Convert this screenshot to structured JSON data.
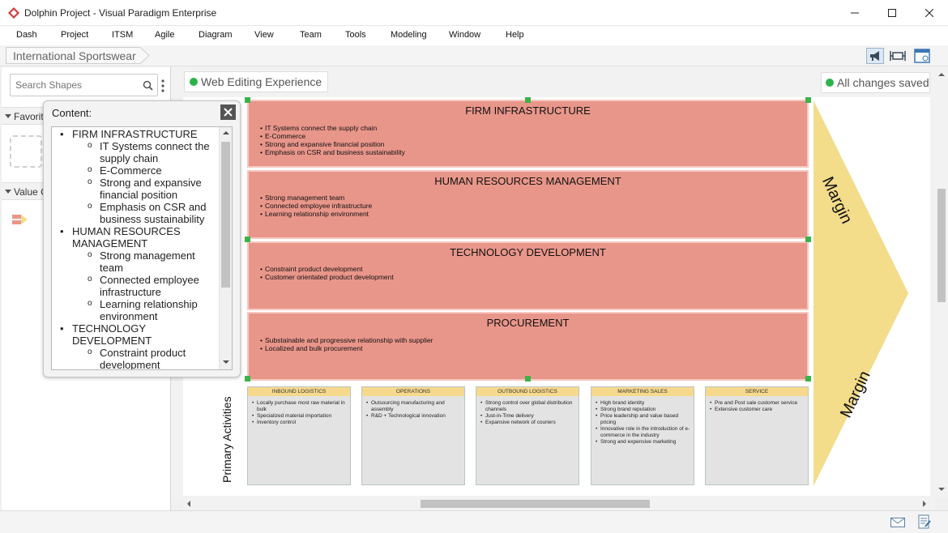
{
  "window": {
    "title": "Dolphin Project - Visual Paradigm Enterprise"
  },
  "menu": [
    "Dash",
    "Project",
    "ITSM",
    "Agile",
    "Diagram",
    "View",
    "Team",
    "Tools",
    "Modeling",
    "Window",
    "Help"
  ],
  "breadcrumb": "International Sportswear",
  "left_panel": {
    "search_placeholder": "Search Shapes",
    "sections": [
      "Favorit",
      "Value C"
    ]
  },
  "status": {
    "left": "Web Editing Experience",
    "right": "All changes saved"
  },
  "support_activities": [
    {
      "title": "FIRM INFRASTRUCTURE",
      "items": [
        "IT Systems connect the supply chain",
        "E-Commerce",
        "Strong and expansive financial position",
        "Emphasis on CSR and business sustainability"
      ]
    },
    {
      "title": "HUMAN RESOURCES MANAGEMENT",
      "items": [
        "Strong management team",
        "Connected employee infrastructure",
        "Learning relationship environment"
      ]
    },
    {
      "title": "TECHNOLOGY DEVELOPMENT",
      "items": [
        "Constraint product development",
        "Customer orientated product development"
      ]
    },
    {
      "title": "PROCUREMENT",
      "items": [
        "Substainable and progressive relationship with supplier",
        "Localized and bulk procurement"
      ]
    }
  ],
  "primary_label": "Primary Activities",
  "primary_activities": [
    {
      "title": "INBOUND LOGISTICS",
      "items": [
        "Locally purchase most raw material in bulk",
        "Specialized material importation",
        "Inventory control"
      ]
    },
    {
      "title": "OPERATIONS",
      "items": [
        "Outsourcing manufacturing and assembly",
        "R&D + Technological innovation"
      ]
    },
    {
      "title": "OUTBOUND LOGISTICS",
      "items": [
        "Strong control over global distribution channels",
        "Just-in-Time delivery",
        "Expansive network of couriers"
      ]
    },
    {
      "title": "MARKETING SALES",
      "items": [
        "High brand identity",
        "Strong brand reputation",
        "Price leadership and value based pricing",
        "Innovative role in the introduction of e-commerce in the industry",
        "Strong and expensive marketing"
      ]
    },
    {
      "title": "SERVICE",
      "items": [
        "Pre and Post sale customer service",
        "Extensive customer care"
      ]
    }
  ],
  "margin_labels": [
    "Margin",
    "Margin"
  ],
  "popup": {
    "title": "Content:",
    "items": [
      {
        "text": "FIRM INFRASTRUCTURE",
        "children": [
          "IT Systems connect the supply chain",
          "E-Commerce",
          "Strong and expansive financial position",
          "Emphasis on CSR and business sustainability"
        ]
      },
      {
        "text": "HUMAN RESOURCES MANAGEMENT",
        "children": [
          "Strong management team",
          "Connected employee infrastructure",
          "Learning relationship environment"
        ]
      },
      {
        "text": "TECHNOLOGY DEVELOPMENT",
        "children": [
          "Constraint product development"
        ]
      }
    ]
  },
  "colors": {
    "support_fill": "#e9968a",
    "primary_header": "#f6d98c",
    "margin_fill": "#f3dc8a",
    "handle": "#3cb34a"
  }
}
